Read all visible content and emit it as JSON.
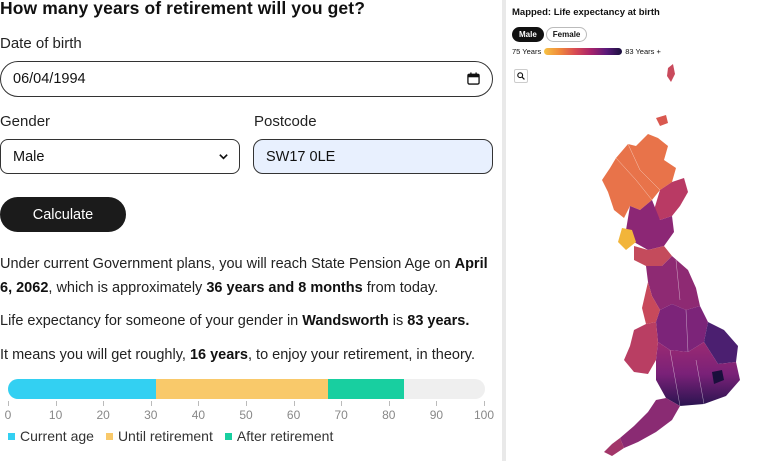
{
  "form": {
    "heading": "How many years of retirement will you get?",
    "dob_label": "Date of birth",
    "dob_value": "06/04/1994",
    "gender_label": "Gender",
    "gender_value": "Male",
    "postcode_label": "Postcode",
    "postcode_value": "SW17 0LE",
    "calculate_label": "Calculate"
  },
  "result": {
    "p1_a": "Under current Government plans, you will reach State Pension Age on ",
    "p1_date": "April 6, 2062",
    "p1_b": ", which is approximately ",
    "p1_duration": "36 years and 8 months",
    "p1_c": " from today.",
    "p2_a": "Life expectancy for someone of your gender in ",
    "p2_area": "Wandsworth",
    "p2_b": " is ",
    "p2_value": "83 years.",
    "p3_a": "It means you will get roughly, ",
    "p3_value": "16 years",
    "p3_b": ", to enjoy your retirement, in theory."
  },
  "bar": {
    "current_age": 31,
    "retirement_age": 67,
    "life_expectancy": 83,
    "max": 100,
    "ticks": [
      "0",
      "10",
      "20",
      "30",
      "40",
      "50",
      "60",
      "70",
      "80",
      "90",
      "100"
    ],
    "colors": {
      "current": "#33d0f2",
      "until": "#f9c96a",
      "after": "#18cfa0",
      "track": "#efefef"
    }
  },
  "legend": {
    "current": "Current age",
    "until": "Until retirement",
    "after": "After retirement"
  },
  "map": {
    "title": "Mapped: Life expectancy at birth",
    "toggle_male": "Male",
    "toggle_female": "Female",
    "scale_min": "75 Years",
    "scale_max": "83 Years +"
  }
}
